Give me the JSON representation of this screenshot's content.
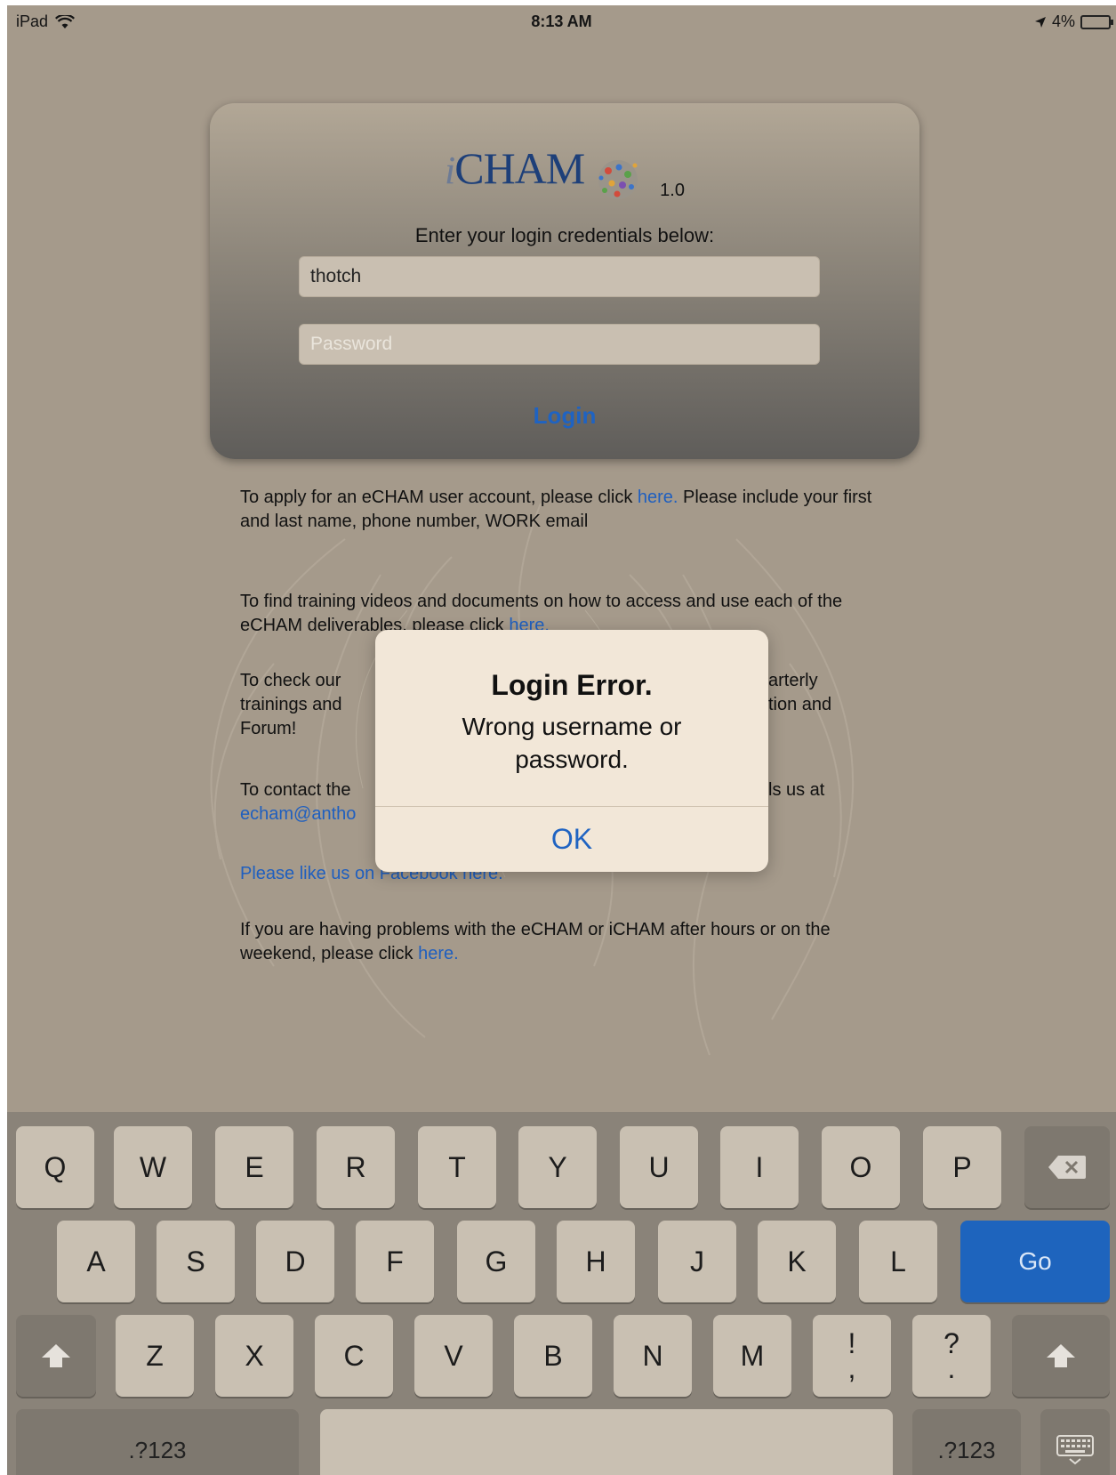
{
  "status_bar": {
    "device": "iPad",
    "time": "8:13 AM",
    "battery": "4%"
  },
  "login": {
    "logo_prefix": "i",
    "logo_name": "CHAM",
    "version": "1.0",
    "prompt": "Enter your login credentials below:",
    "username_value": "thotch",
    "password_placeholder": "Password",
    "login_label": "Login"
  },
  "info": {
    "apply_text": "To apply for an eCHAM user account, please click ",
    "apply_link": "here.",
    "apply_text2": "  Please include your first and last name, phone number, WORK email",
    "training_text": "To find training videos and documents on how to access and use each of the eCHAM deliverables, please click ",
    "training_link": "here.",
    "check_text_a": "To check our ",
    "check_text_b": "arterly",
    "check_text_c": "trainings and ",
    "check_text_d": "tion and",
    "check_text_e": "Forum!",
    "contact_text_a": "To contact the",
    "contact_text_b": "ls us at",
    "contact_email": "echam@antho",
    "facebook_link": "Please like us on Facebook here.",
    "problems_text": "If you are having problems with the eCHAM or iCHAM after hours or on the weekend, please click ",
    "problems_link": "here."
  },
  "alert": {
    "title": "Login Error.",
    "message": "Wrong username or password.",
    "ok_label": "OK"
  },
  "keyboard": {
    "row1": [
      "Q",
      "W",
      "E",
      "R",
      "T",
      "Y",
      "U",
      "I",
      "O",
      "P"
    ],
    "row2": [
      "A",
      "S",
      "D",
      "F",
      "G",
      "H",
      "J",
      "K",
      "L"
    ],
    "row3": [
      "Z",
      "X",
      "C",
      "V",
      "B",
      "N",
      "M"
    ],
    "go_label": "Go",
    "numbers_label_left": ".?123",
    "numbers_label_right": ".?123",
    "exclaim_top": "!",
    "exclaim_bottom": ",",
    "question_top": "?",
    "question_bottom": "."
  },
  "colors": {
    "accent": "#1f63c2",
    "go_key": "#1e64bd"
  }
}
